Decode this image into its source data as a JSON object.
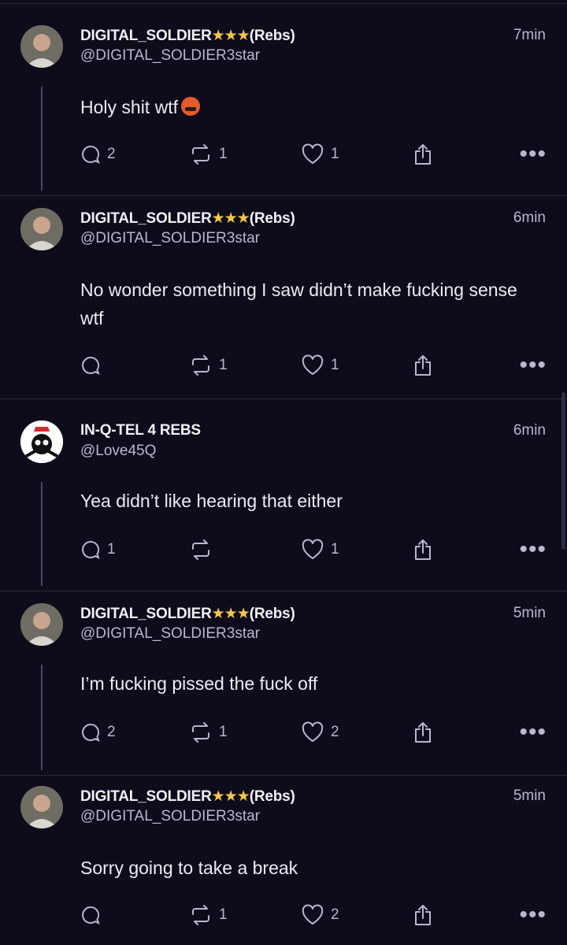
{
  "posts": [
    {
      "name": "DIGITAL_SOLDIER",
      "stars": "★★★",
      "tag": "(Rebs)",
      "handle": "@DIGITAL_SOLDIER3star",
      "time": "7min",
      "text": "Holy shit wtf",
      "emoji": "face-with-symbols-on-mouth",
      "replies": "2",
      "reposts": "1",
      "likes": "1"
    },
    {
      "name": "DIGITAL_SOLDIER",
      "stars": "★★★",
      "tag": "(Rebs)",
      "handle": "@DIGITAL_SOLDIER3star",
      "time": "6min",
      "text": "No wonder something I saw didn’t make fucking sense wtf",
      "replies": "",
      "reposts": "1",
      "likes": "1"
    },
    {
      "name": "IN-Q-TEL 4 REBS",
      "stars": "",
      "tag": "",
      "handle": "@Love45Q",
      "time": "6min",
      "text": "Yea didn’t like hearing that either",
      "replies": "1",
      "reposts": "",
      "likes": "1"
    },
    {
      "name": "DIGITAL_SOLDIER",
      "stars": "★★★",
      "tag": "(Rebs)",
      "handle": "@DIGITAL_SOLDIER3star",
      "time": "5min",
      "text": "I’m fucking pissed the fuck off",
      "replies": "2",
      "reposts": "1",
      "likes": "2"
    },
    {
      "name": "DIGITAL_SOLDIER",
      "stars": "★★★",
      "tag": "(Rebs)",
      "handle": "@DIGITAL_SOLDIER3star",
      "time": "5min",
      "text": "Sorry going to take a break",
      "replies": "",
      "reposts": "1",
      "likes": "2"
    }
  ],
  "icons": {
    "reply": "reply-icon",
    "repost": "repost-icon",
    "like": "heart-icon",
    "share": "share-icon",
    "more": "more-options-icon"
  },
  "colors": {
    "background": "#0e0c1b",
    "star": "#f4c64a",
    "muted": "#b9b7c8"
  }
}
